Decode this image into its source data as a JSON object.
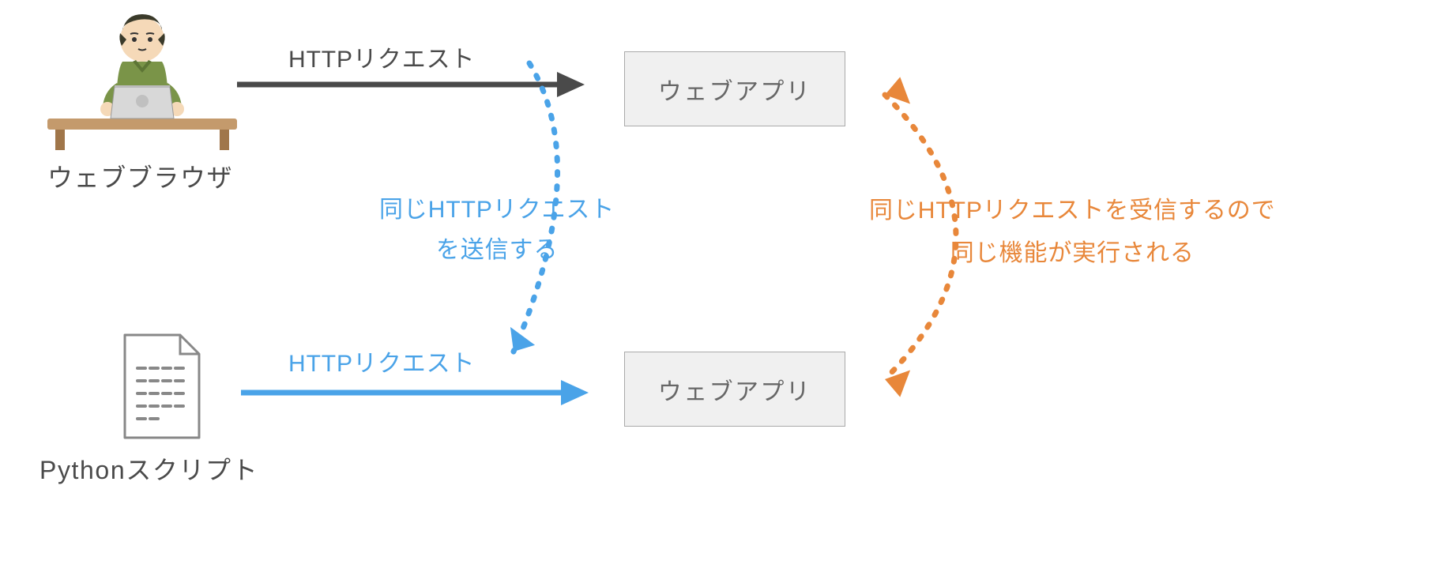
{
  "browser": {
    "label": "ウェブブラウザ"
  },
  "script": {
    "label": "Pythonスクリプト"
  },
  "webapp": {
    "label": "ウェブアプリ"
  },
  "arrow_top": {
    "label": "HTTPリクエスト"
  },
  "arrow_bottom": {
    "label": "HTTPリクエスト"
  },
  "blue_note": {
    "line1": "同じHTTPリクエスト",
    "line2": "を送信する"
  },
  "orange_note": {
    "line1": "同じHTTPリクエストを受信するので",
    "line2": "同じ機能が実行される"
  },
  "colors": {
    "blue": "#4aa3e8",
    "orange": "#e8873a",
    "gray": "#4a4a4a"
  }
}
